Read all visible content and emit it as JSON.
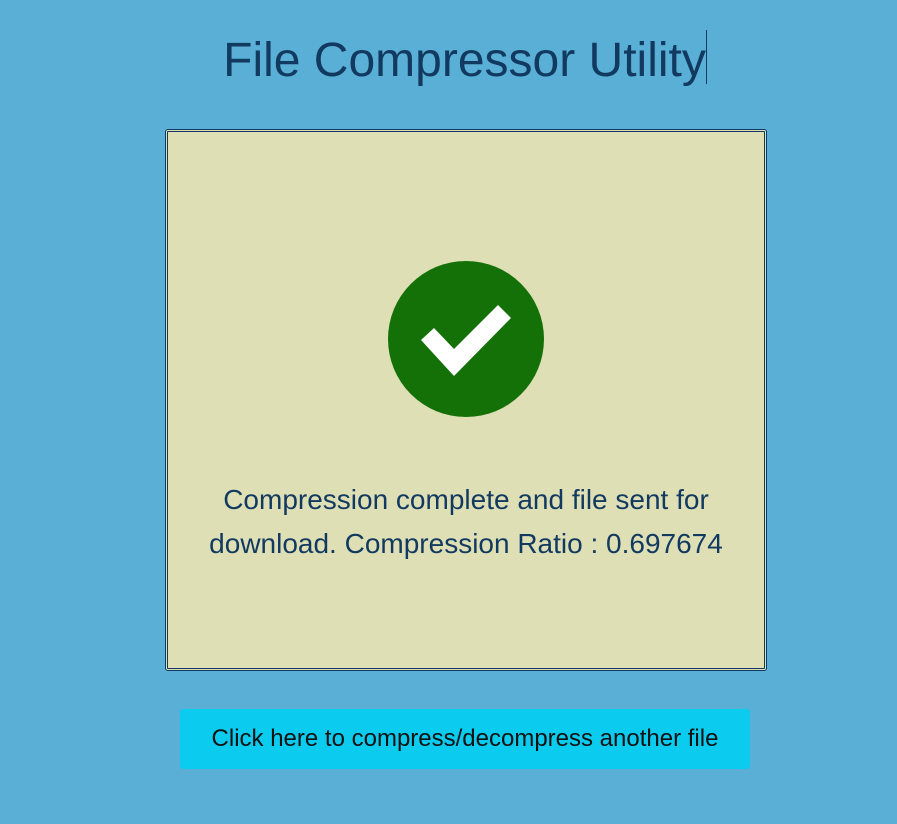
{
  "header": {
    "title": "File Compressor Utility"
  },
  "result": {
    "status_icon": "success-check-icon",
    "message": "Compression complete and file sent for download. Compression Ratio : 0.697674"
  },
  "actions": {
    "restart_label": "Click here to compress/decompress another file"
  },
  "colors": {
    "background": "#5aafd6",
    "panel": "#dfdfb6",
    "text": "#123a60",
    "success": "#137107",
    "button": "#0bcbef"
  }
}
